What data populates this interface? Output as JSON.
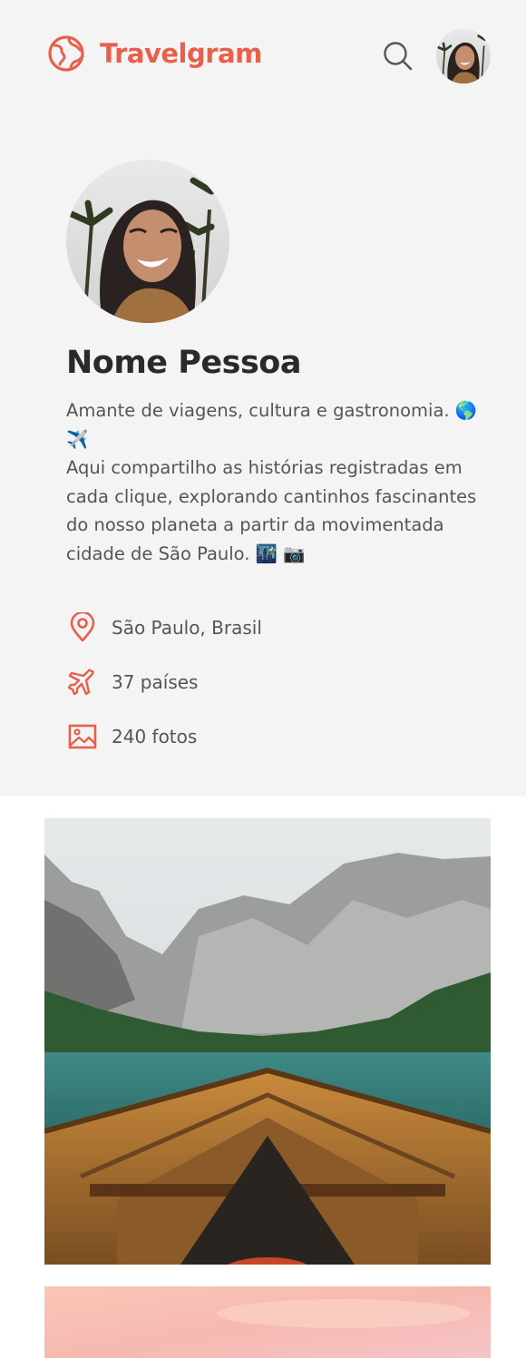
{
  "header": {
    "brand": "Travelgram",
    "logo_icon": "globe-icon",
    "search_icon": "search-icon"
  },
  "profile": {
    "name": "Nome Pessoa",
    "bio_line1": "Amante de viagens, cultura e gastronomia. 🌎 ✈️",
    "bio_line2": "Aqui compartilho as histórias registradas em cada clique, explorando cantinhos fascinantes do nosso planeta a partir da movimentada cidade de São Paulo. 🌃 📷",
    "stats": [
      {
        "icon": "map-pin-icon",
        "label": "São Paulo, Brasil"
      },
      {
        "icon": "plane-icon",
        "label": "37 países"
      },
      {
        "icon": "image-icon",
        "label": "240 fotos"
      }
    ]
  },
  "colors": {
    "accent": "#e8604c",
    "background": "#f4f4f4"
  }
}
